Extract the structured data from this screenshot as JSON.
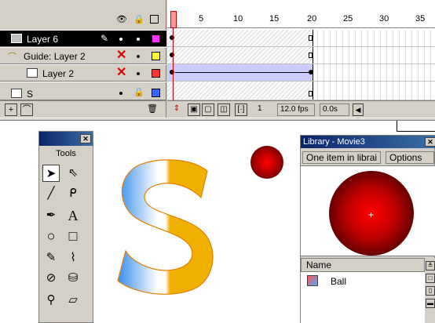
{
  "timeline": {
    "header_icons": {
      "eye": "eye-icon",
      "lock": "lock-icon",
      "outline": "outline-square-icon"
    },
    "ruler": [
      "1",
      "5",
      "10",
      "15",
      "20",
      "25",
      "30",
      "35"
    ],
    "layers": [
      {
        "name": "Layer 6",
        "selected": true,
        "color": "#ff33ff",
        "icon": "layer-icon"
      },
      {
        "name": "Guide: Layer 2",
        "selected": false,
        "color": "#ffff33",
        "icon": "guide-layer-icon"
      },
      {
        "name": "Layer 2",
        "selected": false,
        "color": "#ff3333",
        "icon": "layer-icon"
      },
      {
        "name": "S",
        "selected": false,
        "color": "#3366ff",
        "icon": "layer-icon"
      }
    ],
    "frame_toolbar": {
      "current_frame": "1",
      "fps": "12.0 fps",
      "elapsed": "0.0s"
    }
  },
  "tools": {
    "title": "Tools",
    "items": [
      {
        "name": "arrow-tool-icon",
        "glyph": "➤"
      },
      {
        "name": "subselect-tool-icon",
        "glyph": "⇖"
      },
      {
        "name": "line-tool-icon",
        "glyph": "╱"
      },
      {
        "name": "lasso-tool-icon",
        "glyph": "ᑭ"
      },
      {
        "name": "pen-tool-icon",
        "glyph": "✒"
      },
      {
        "name": "text-tool-icon",
        "glyph": "A"
      },
      {
        "name": "oval-tool-icon",
        "glyph": "○"
      },
      {
        "name": "rectangle-tool-icon",
        "glyph": "□"
      },
      {
        "name": "pencil-tool-icon",
        "glyph": "✎"
      },
      {
        "name": "brush-tool-icon",
        "glyph": "🖌"
      },
      {
        "name": "ink-bottle-tool-icon",
        "glyph": "⊘"
      },
      {
        "name": "paint-bucket-tool-icon",
        "glyph": "⛁"
      },
      {
        "name": "dropper-tool-icon",
        "glyph": "⚲"
      },
      {
        "name": "eraser-tool-icon",
        "glyph": "▱"
      }
    ]
  },
  "library": {
    "title": "Library - Movie3",
    "count_tab": "One item in librai",
    "options_tab": "Options",
    "column_name": "Name",
    "items": [
      {
        "name": "Ball",
        "icon": "movie-clip-icon"
      }
    ]
  },
  "stage": {
    "s_gradient_left": "#3a8ef0",
    "s_gradient_right": "#f0b000",
    "outline_color": "#e08000"
  }
}
